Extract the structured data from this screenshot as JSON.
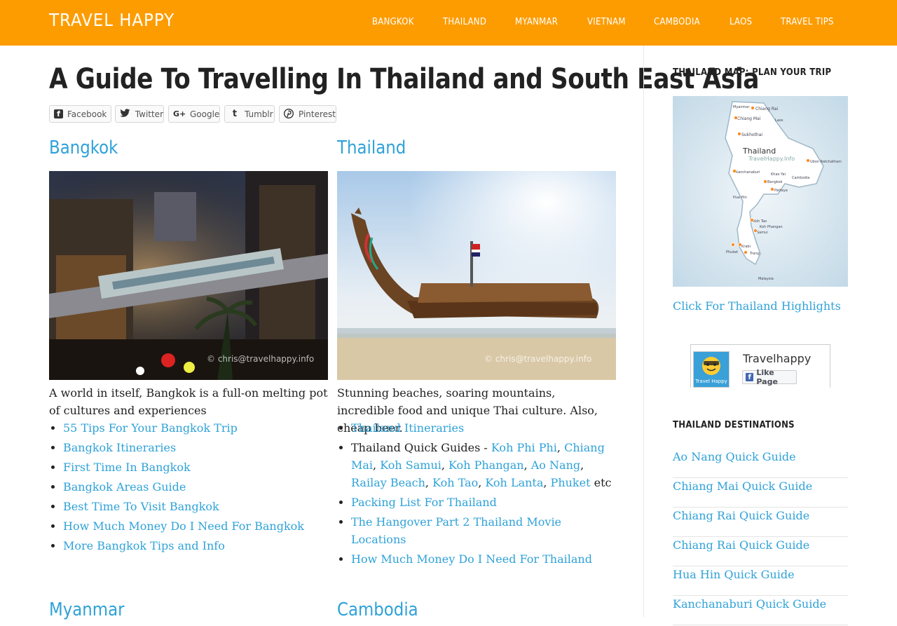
{
  "header": {
    "brand": "TRAVEL HAPPY",
    "nav": [
      "BANGKOK",
      "THAILAND",
      "MYANMAR",
      "VIETNAM",
      "CAMBODIA",
      "LAOS",
      "TRAVEL TIPS"
    ]
  },
  "page": {
    "title": "A Guide To Travelling In Thailand and South East Asia"
  },
  "share": {
    "facebook": "Facebook",
    "twitter": "Twitter",
    "google": "Google",
    "tumblr": "Tumblr",
    "pinterest": "Pinterest"
  },
  "bangkok": {
    "title": "Bangkok",
    "watermark": "© chris@travelhappy.info",
    "description": "A world in itself, Bangkok is a full-on melting pot of cultures and experiences",
    "links": [
      "55 Tips For Your Bangkok Trip",
      "Bangkok Itineraries",
      "First Time In Bangkok",
      "Bangkok Areas Guide",
      "Best Time To Visit Bangkok",
      "How Much Money Do I Need For Bangkok",
      "More Bangkok Tips and Info"
    ]
  },
  "thailand": {
    "title": "Thailand",
    "watermark": "© chris@travelhappy.info",
    "description": "Stunning beaches, soaring mountains, incredible food and unique Thai culture. Also, cheap beer.",
    "link_itineraries": "Thailand Itineraries",
    "quick_guides_label": "Thailand Quick Guides - ",
    "quick_guides": [
      "Koh Phi Phi",
      "Chiang Mai",
      "Koh Samui",
      "Koh Phangan",
      "Ao Nang",
      "Railay Beach",
      "Koh Tao",
      "Koh Lanta",
      "Phuket"
    ],
    "quick_guides_suffix": " etc",
    "link_packing": "Packing List For Thailand",
    "link_hangover": "The Hangover Part 2 Thailand Movie Locations",
    "link_money": "How Much Money Do I Need For Thailand"
  },
  "lower": {
    "myanmar": "Myanmar",
    "cambodia": "Cambodia"
  },
  "sidebar": {
    "map_heading": "THAILAND MAP: PLAN YOUR TRIP",
    "map_labels": [
      "Myanmar",
      "Chiang Rai",
      "Chiang Mai",
      "Laos",
      "Sukhothai",
      "Thailand",
      "TravelHappy.Info",
      "Ubon Ratchathani",
      "Kanchanaburi",
      "Khao Yai",
      "Bangkok",
      "Cambodia",
      "Pattaya",
      "Hua Hin",
      "Koh Tao",
      "Koh Phangan",
      "Samui",
      "Krabi",
      "Phuket",
      "Trang",
      "Malaysia"
    ],
    "map_link": "Click For Thailand Highlights",
    "fb_name": "Travelhappy",
    "fb_like": "Like Page",
    "fb_logo": "Travel Happy",
    "dest_heading": "THAILAND DESTINATIONS",
    "destinations": [
      "Ao Nang Quick Guide",
      "Chiang Mai Quick Guide",
      "Chiang Rai Quick Guide",
      "Chiang Rai Quick Guide",
      "Hua Hin Quick Guide",
      "Kanchanaburi Quick Guide"
    ]
  },
  "colors": {
    "header_bg": "#fd9c00",
    "link": "#2fa2d8",
    "text": "#222222"
  }
}
